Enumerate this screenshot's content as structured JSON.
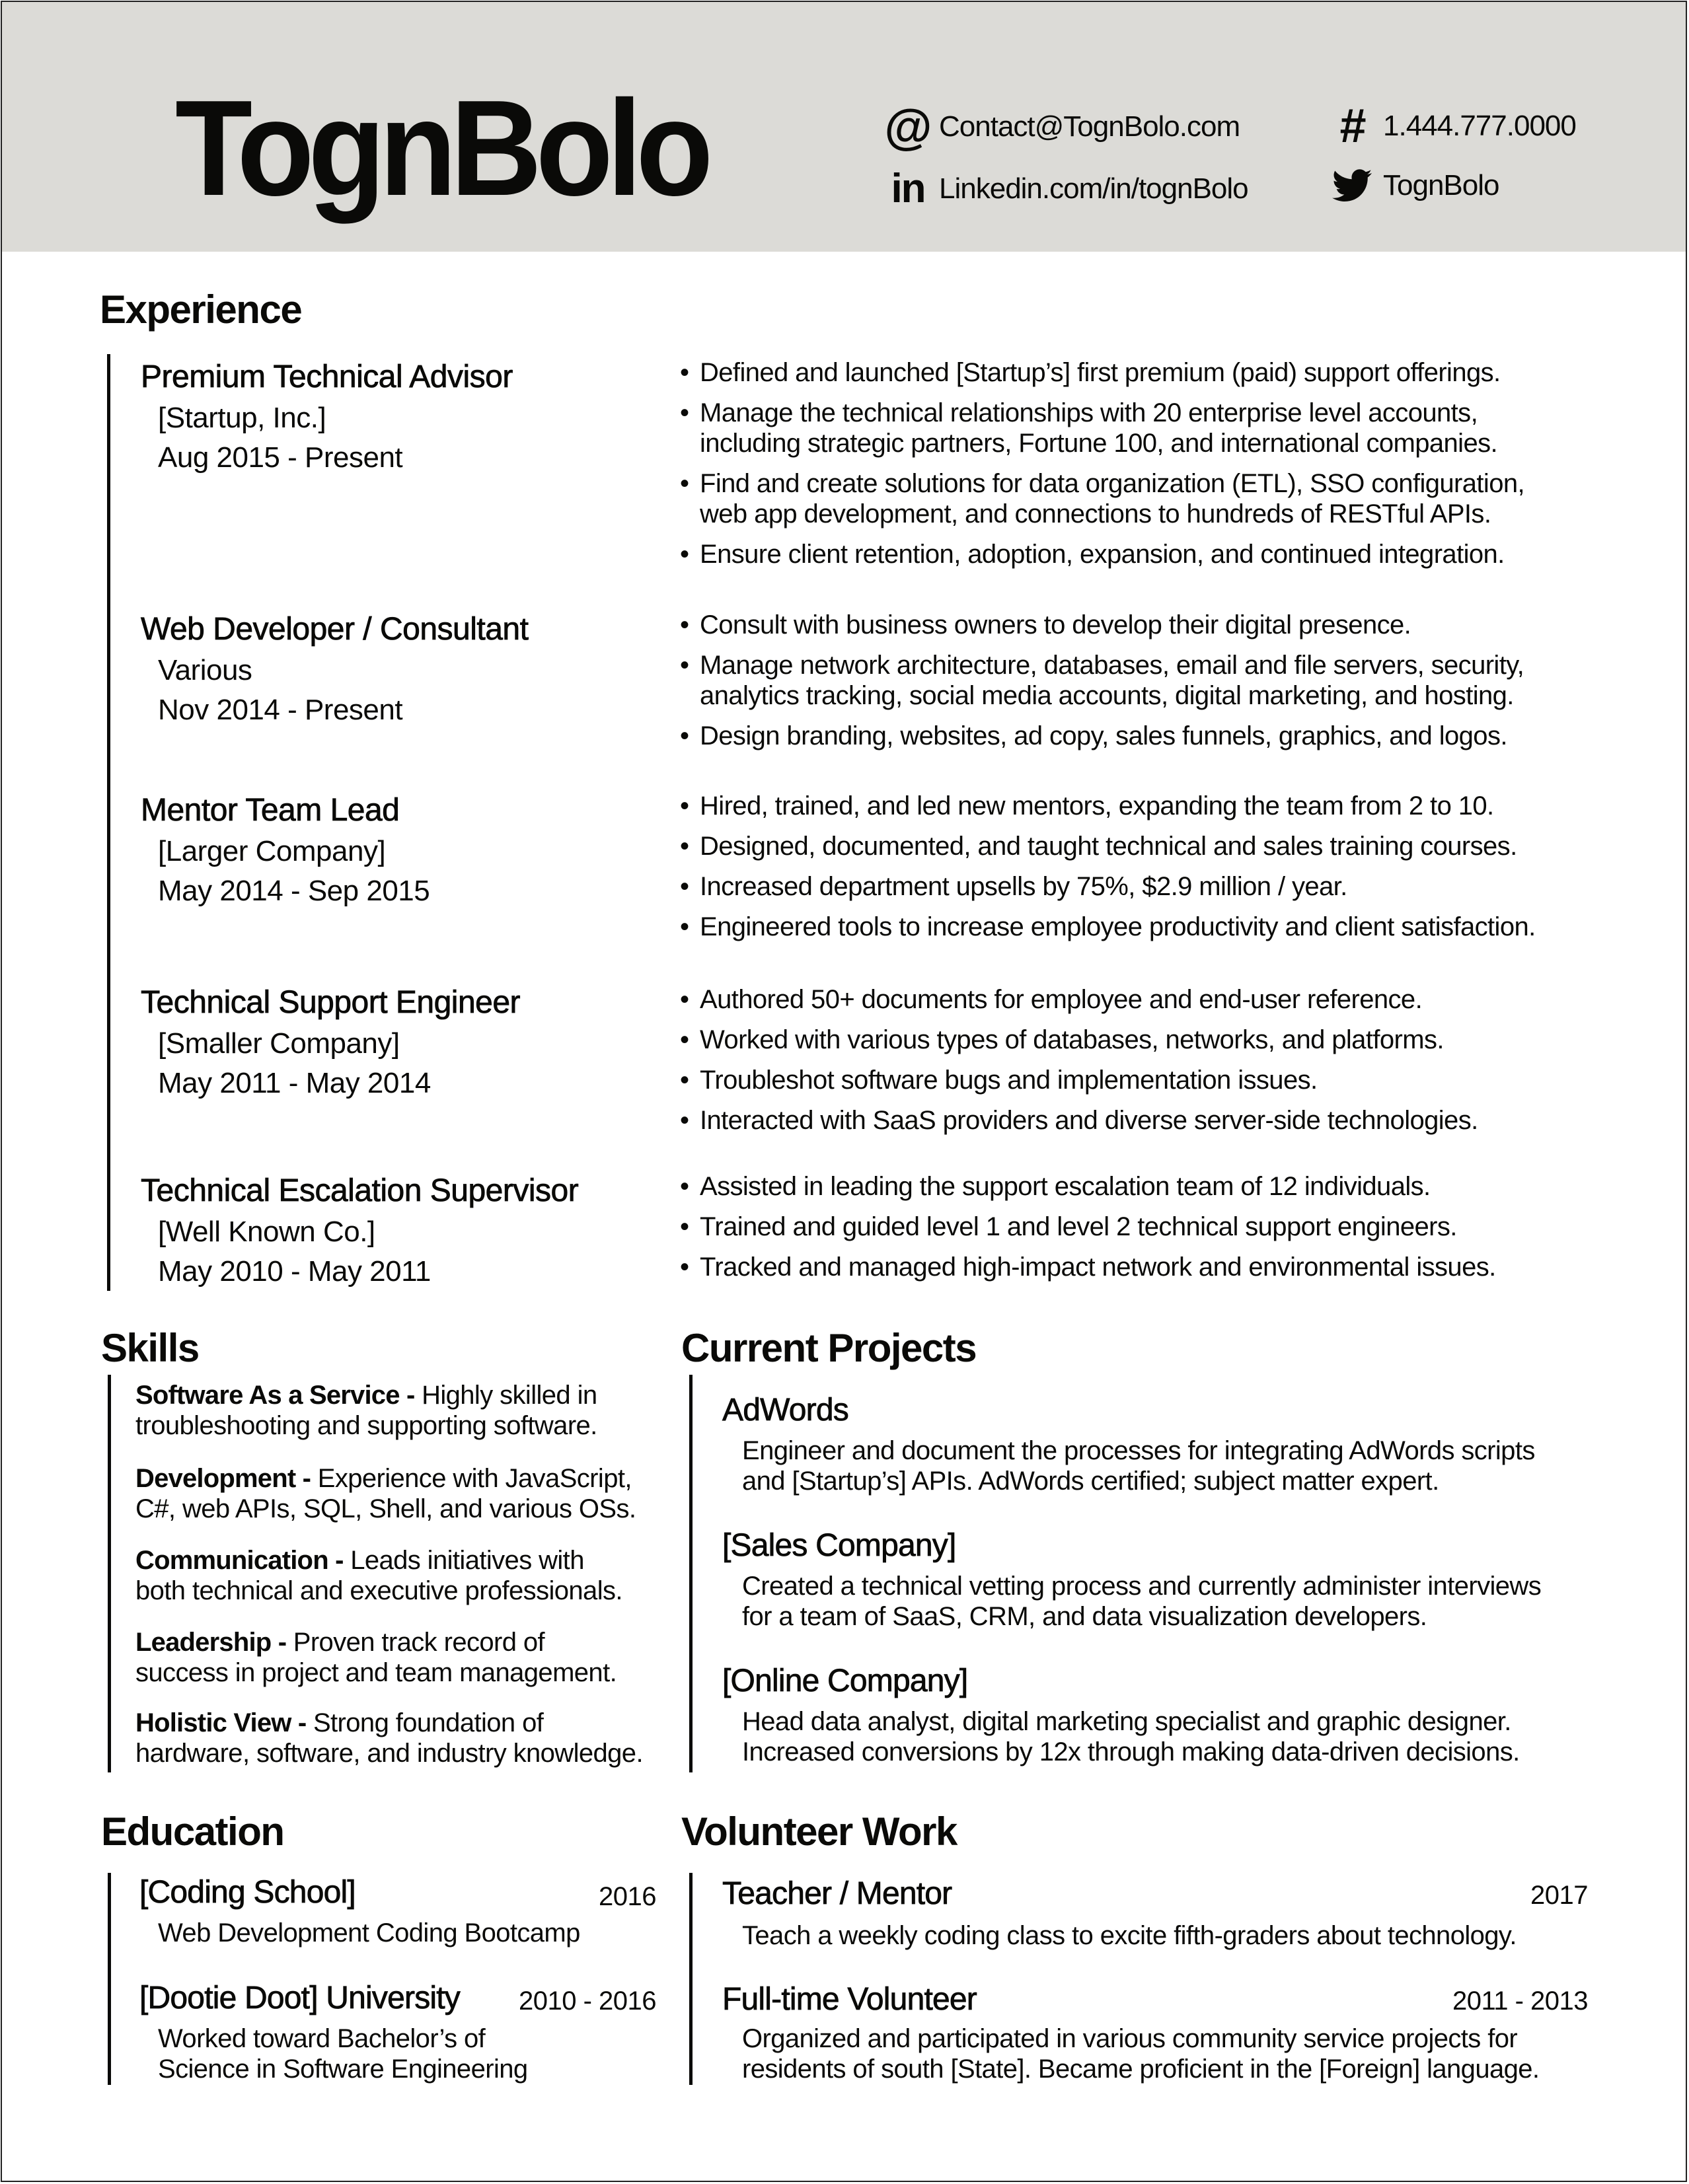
{
  "header": {
    "name": "TognBolo",
    "contacts": {
      "email": {
        "icon": "at-icon",
        "glyph": "@",
        "value": "Contact@TognBolo.com"
      },
      "phone": {
        "icon": "hash-icon",
        "glyph": "#",
        "value": "1.444.777.0000"
      },
      "linkedin": {
        "icon": "linkedin-icon",
        "glyph": "in",
        "value": "Linkedin.com/in/tognBolo"
      },
      "twitter": {
        "icon": "twitter-icon",
        "value": "TognBolo"
      }
    },
    "background_color": "#dcdbd7"
  },
  "experience": {
    "title": "Experience",
    "jobs": [
      {
        "title": "Premium Technical Advisor",
        "company": "[Startup, Inc.]",
        "dates": "Aug 2015 - Present",
        "bullets": [
          "Defined and launched [Startup’s] first premium (paid) support offerings.",
          "Manage the technical relationships with 20 enterprise level accounts,\nincluding strategic partners, Fortune 100, and international companies.",
          "Find and create solutions for data organization (ETL), SSO configuration,\nweb app development, and connections to hundreds of RESTful APIs.",
          "Ensure client retention, adoption, expansion, and continued integration."
        ]
      },
      {
        "title": "Web Developer / Consultant",
        "company": "Various",
        "dates": "Nov 2014 - Present",
        "bullets": [
          "Consult with business owners to develop their digital presence.",
          "Manage network architecture, databases, email and file servers, security,\nanalytics tracking, social media accounts, digital marketing, and hosting.",
          "Design branding, websites, ad copy, sales funnels, graphics, and logos."
        ]
      },
      {
        "title": "Mentor Team Lead",
        "company": "[Larger Company]",
        "dates": "May 2014 - Sep 2015",
        "bullets": [
          "Hired, trained, and led new mentors, expanding the team from 2 to 10.",
          "Designed, documented, and taught technical and sales training courses.",
          "Increased department upsells by 75%, $2.9 million / year.",
          "Engineered tools to increase employee productivity and client satisfaction."
        ]
      },
      {
        "title": "Technical Support Engineer",
        "company": "[Smaller Company]",
        "dates": "May 2011 - May 2014",
        "bullets": [
          "Authored 50+ documents for employee and end-user reference.",
          "Worked with various types of databases, networks, and platforms.",
          "Troubleshot software bugs and implementation issues.",
          "Interacted with SaaS providers and diverse server-side technologies."
        ]
      },
      {
        "title": "Technical Escalation Supervisor",
        "company": "[Well Known Co.]",
        "dates": "May 2010 - May 2011",
        "bullets": [
          "Assisted in leading the support escalation team of 12 individuals.",
          "Trained and guided level 1 and level 2 technical support engineers.",
          "Tracked and managed high-impact network and environmental issues."
        ]
      }
    ]
  },
  "skills": {
    "title": "Skills",
    "items": [
      {
        "name": "Software As a Service -",
        "desc": "Highly skilled in",
        "desc2": "troubleshooting and supporting software."
      },
      {
        "name": "Development -",
        "desc": "Experience with JavaScript,",
        "desc2": "C#, web APIs, SQL, Shell, and various OSs."
      },
      {
        "name": "Communication -",
        "desc": "Leads initiatives with",
        "desc2": "both technical and executive professionals."
      },
      {
        "name": "Leadership -",
        "desc": "Proven track record of",
        "desc2": "success in project and team management."
      },
      {
        "name": "Holistic View -",
        "desc": "Strong foundation of",
        "desc2": "hardware, software, and industry knowledge."
      }
    ]
  },
  "projects": {
    "title": "Current Projects",
    "items": [
      {
        "name": "AdWords",
        "line1": "Engineer and document the processes for integrating AdWords scripts",
        "line2": "and [Startup’s] APIs. AdWords certified; subject matter expert."
      },
      {
        "name": "[Sales Company]",
        "line1": "Created a technical vetting process and currently administer interviews",
        "line2": "for a team of SaaS, CRM, and data visualization developers."
      },
      {
        "name": "[Online Company]",
        "line1": "Head data analyst, digital marketing specialist and graphic designer.",
        "line2": "Increased conversions by 12x through making data-driven decisions."
      }
    ]
  },
  "education": {
    "title": "Education",
    "items": [
      {
        "school": "[Coding School]",
        "years": "2016",
        "line1": "Web Development Coding Bootcamp",
        "line2": ""
      },
      {
        "school": "[Dootie Doot] University",
        "years": "2010 - 2016",
        "line1": "Worked toward Bachelor’s of",
        "line2": "Science in Software Engineering"
      }
    ]
  },
  "volunteer": {
    "title": "Volunteer Work",
    "items": [
      {
        "role": "Teacher / Mentor",
        "years": "2017",
        "line1": "Teach a weekly coding class to excite fifth-graders about technology.",
        "line2": ""
      },
      {
        "role": "Full-time Volunteer",
        "years": "2011 - 2013",
        "line1": "Organized and participated in various community service projects for",
        "line2": "residents of south [State]. Became proficient in the [Foreign] language."
      }
    ]
  }
}
